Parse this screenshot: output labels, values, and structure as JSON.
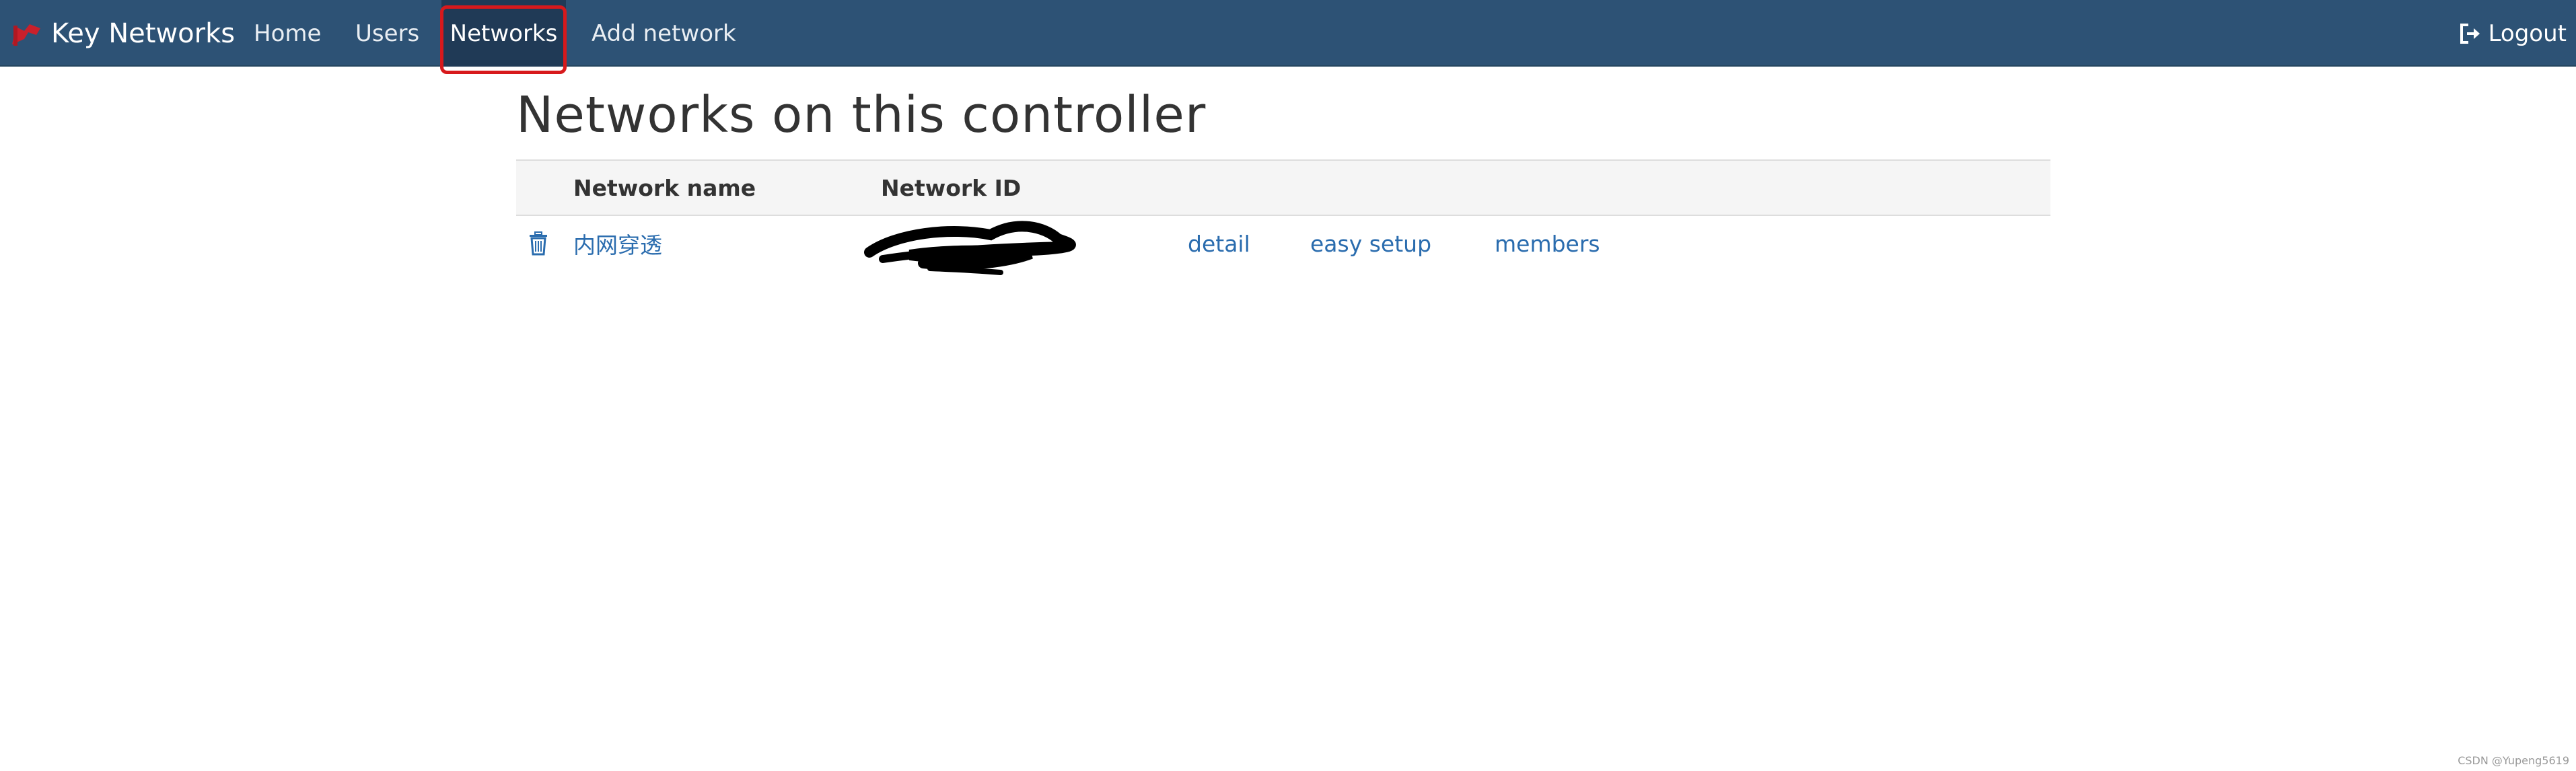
{
  "navbar": {
    "brand_label": "Key Networks",
    "items": [
      {
        "label": "Home",
        "active": false
      },
      {
        "label": "Users",
        "active": false
      },
      {
        "label": "Networks",
        "active": true
      },
      {
        "label": "Add network",
        "active": false
      }
    ],
    "logout_label": "Logout",
    "colors": {
      "background": "#2d5275",
      "active": "#203a56",
      "highlight_outline": "#d7191c"
    }
  },
  "main": {
    "title": "Networks on this controller",
    "table": {
      "headers": [
        "Network name",
        "Network ID"
      ],
      "rows": [
        {
          "name": "内网穿透",
          "network_id": "",
          "actions": [
            "detail",
            "easy setup",
            "members"
          ]
        }
      ]
    }
  },
  "icons": {
    "brand": "key-network-logo-icon",
    "logout": "logout-icon",
    "delete": "trash-icon"
  },
  "watermark": "CSDN @Yupeng5619"
}
